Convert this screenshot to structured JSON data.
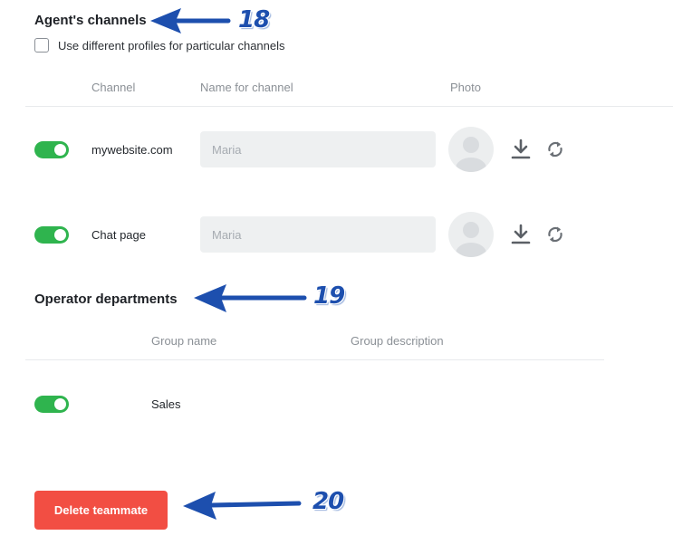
{
  "agent_channels": {
    "title": "Agent's channels",
    "checkbox_label": "Use different profiles for particular channels",
    "checkbox_checked": false,
    "columns": {
      "channel": "Channel",
      "name": "Name for channel",
      "photo": "Photo"
    },
    "rows": [
      {
        "enabled": true,
        "channel": "mywebsite.com",
        "name_placeholder": "Maria",
        "name_value": ""
      },
      {
        "enabled": true,
        "channel": "Chat page",
        "name_placeholder": "Maria",
        "name_value": ""
      }
    ]
  },
  "operator_departments": {
    "title": "Operator departments",
    "columns": {
      "group_name": "Group name",
      "group_description": "Group description"
    },
    "rows": [
      {
        "enabled": true,
        "group_name": "Sales",
        "group_description": ""
      }
    ]
  },
  "actions": {
    "delete_label": "Delete teammate"
  },
  "annotations": {
    "callout_1": "18",
    "callout_2": "19",
    "callout_3": "20",
    "arrow_color": "#1d4fae"
  },
  "colors": {
    "toggle_on": "#2fb44e",
    "delete_button": "#f24e43",
    "input_bg": "#eef0f1"
  }
}
